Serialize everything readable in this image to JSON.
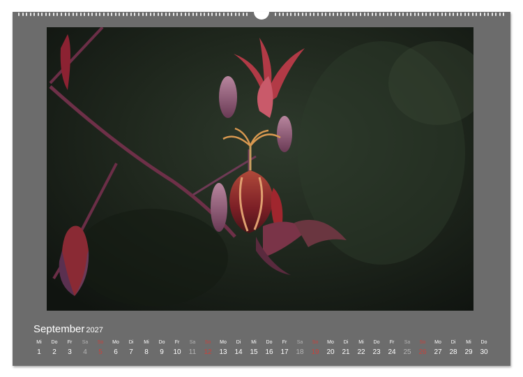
{
  "calendar": {
    "month": "September",
    "year": "2027",
    "colors": {
      "weekday": "#ffffff",
      "saturday": "#b5b5b5",
      "sunday": "#c8423c",
      "page": "#6c6c6c"
    },
    "days": [
      {
        "dn": "Mi",
        "d": "1",
        "type": "weekday"
      },
      {
        "dn": "Do",
        "d": "2",
        "type": "weekday"
      },
      {
        "dn": "Fr",
        "d": "3",
        "type": "weekday"
      },
      {
        "dn": "Sa",
        "d": "4",
        "type": "sat"
      },
      {
        "dn": "So",
        "d": "5",
        "type": "sun"
      },
      {
        "dn": "Mo",
        "d": "6",
        "type": "weekday"
      },
      {
        "dn": "Di",
        "d": "7",
        "type": "weekday"
      },
      {
        "dn": "Mi",
        "d": "8",
        "type": "weekday"
      },
      {
        "dn": "Do",
        "d": "9",
        "type": "weekday"
      },
      {
        "dn": "Fr",
        "d": "10",
        "type": "weekday"
      },
      {
        "dn": "Sa",
        "d": "11",
        "type": "sat"
      },
      {
        "dn": "So",
        "d": "12",
        "type": "sun"
      },
      {
        "dn": "Mo",
        "d": "13",
        "type": "weekday"
      },
      {
        "dn": "Di",
        "d": "14",
        "type": "weekday"
      },
      {
        "dn": "Mi",
        "d": "15",
        "type": "weekday"
      },
      {
        "dn": "Do",
        "d": "16",
        "type": "weekday"
      },
      {
        "dn": "Fr",
        "d": "17",
        "type": "weekday"
      },
      {
        "dn": "Sa",
        "d": "18",
        "type": "sat"
      },
      {
        "dn": "So",
        "d": "19",
        "type": "sun"
      },
      {
        "dn": "Mo",
        "d": "20",
        "type": "weekday"
      },
      {
        "dn": "Di",
        "d": "21",
        "type": "weekday"
      },
      {
        "dn": "Mi",
        "d": "22",
        "type": "weekday"
      },
      {
        "dn": "Do",
        "d": "23",
        "type": "weekday"
      },
      {
        "dn": "Fr",
        "d": "24",
        "type": "weekday"
      },
      {
        "dn": "Sa",
        "d": "25",
        "type": "sat"
      },
      {
        "dn": "So",
        "d": "26",
        "type": "sun"
      },
      {
        "dn": "Mo",
        "d": "27",
        "type": "weekday"
      },
      {
        "dn": "Di",
        "d": "28",
        "type": "weekday"
      },
      {
        "dn": "Mi",
        "d": "29",
        "type": "weekday"
      },
      {
        "dn": "Do",
        "d": "30",
        "type": "weekday"
      }
    ]
  }
}
